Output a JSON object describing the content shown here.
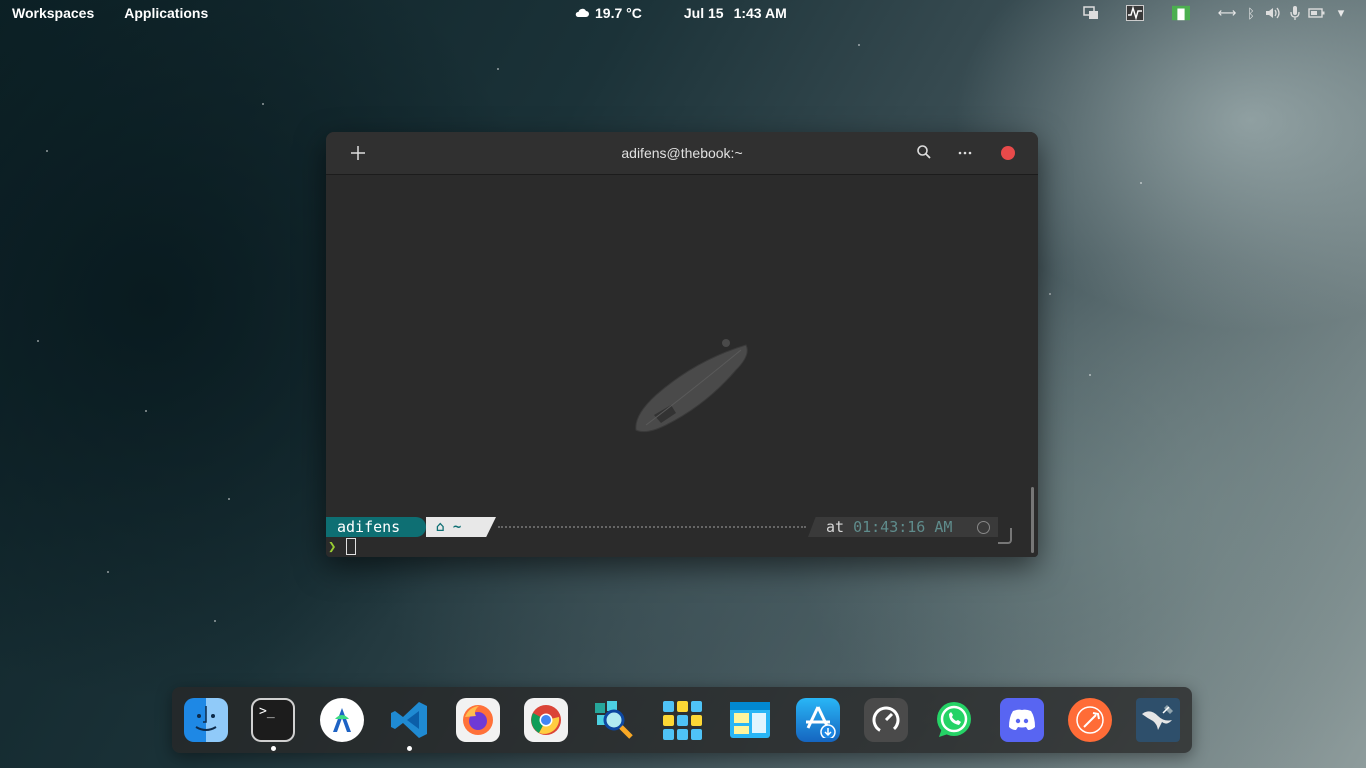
{
  "panel": {
    "workspaces_label": "Workspaces",
    "applications_label": "Applications",
    "weather": {
      "icon": "cloud-icon",
      "temperature": "19.7 °C"
    },
    "date": "Jul 15",
    "time": "1:43 AM",
    "tray_icons": [
      "display-icon",
      "system-monitor-icon",
      "green-app-icon",
      "arrows-icon",
      "bluetooth-icon",
      "volume-icon",
      "microphone-icon",
      "battery-icon",
      "chevron-down-icon"
    ]
  },
  "terminal": {
    "title": "adifens@thebook:~",
    "prompt": {
      "user": "adifens",
      "home_symbol": "⌂",
      "dir": "~",
      "at_label": "at",
      "time": "01:43:16 AM"
    },
    "input_chevron": "❯"
  },
  "dock": {
    "items": [
      {
        "name": "finder",
        "icon": "finder-icon",
        "running": false
      },
      {
        "name": "terminal",
        "icon": "terminal-icon",
        "running": true
      },
      {
        "name": "android-studio",
        "icon": "android-studio-icon",
        "running": false
      },
      {
        "name": "vscode",
        "icon": "vscode-icon",
        "running": true
      },
      {
        "name": "firefox",
        "icon": "firefox-icon",
        "running": false
      },
      {
        "name": "chrome",
        "icon": "chrome-icon",
        "running": false
      },
      {
        "name": "search-tool",
        "icon": "magnifier-app-icon",
        "running": false
      },
      {
        "name": "app-grid",
        "icon": "app-grid-icon",
        "running": false
      },
      {
        "name": "window-manager",
        "icon": "window-manager-icon",
        "running": false
      },
      {
        "name": "app-store",
        "icon": "app-store-icon",
        "running": false
      },
      {
        "name": "speedometer",
        "icon": "speedometer-icon",
        "running": false
      },
      {
        "name": "whatsapp",
        "icon": "whatsapp-icon",
        "running": false
      },
      {
        "name": "discord",
        "icon": "discord-icon",
        "running": false
      },
      {
        "name": "postman",
        "icon": "postman-icon",
        "running": false
      },
      {
        "name": "mysql-workbench",
        "icon": "mysql-workbench-icon",
        "running": false
      }
    ]
  }
}
